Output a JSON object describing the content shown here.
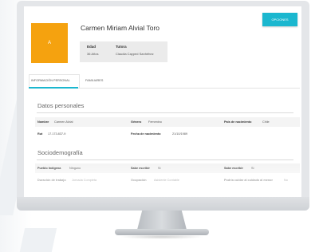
{
  "header": {
    "action_button": "OPCIONES",
    "avatar_initial": "A",
    "patient_name": "Carmen Miriam Alvial Toro"
  },
  "info_box": {
    "age_label": "Edad",
    "age_value": "36 Años",
    "tutor_label": "Tutora",
    "tutor_value": "Claudia Cayped Sanhéhez"
  },
  "tabs": [
    {
      "label": "INFORMACIÓN PERSONAL",
      "active": true
    },
    {
      "label": "FAMILIARES",
      "active": false
    }
  ],
  "personal": {
    "title": "Datos personales",
    "fields": {
      "nombre_label": "Nombre",
      "nombre_value": "Carmen Alvial",
      "genero_label": "Género",
      "genero_value": "Femenino",
      "pais_label": "País de nacimiento",
      "pais_value": "Chile",
      "rut_label": "Rut",
      "rut_value": "17.173.837-9",
      "fecha_label": "Fecha de nacimiento",
      "fecha_value": "21/10/1989"
    }
  },
  "socio": {
    "title": "Sociodemografía",
    "fields": {
      "pueblo_label": "Pueblo Indígena",
      "pueblo_value": "Ninguno",
      "leer_label": "Sabe escribir",
      "leer_value": "Sí",
      "escribir_label": "Sabe escribir",
      "escribir_value": "Sí",
      "jornada_label": "Duración de trabajo",
      "jornada_value": "Jornada Completa",
      "ocupacion_label": "Ocupación",
      "ocupacion_value": "Asistente Contable",
      "cuidado_label": "Podría cuidar al cuidado al menor",
      "cuidado_value": "No"
    }
  },
  "colors": {
    "accent": "#1bb7cf",
    "avatar": "#f5a20f"
  }
}
